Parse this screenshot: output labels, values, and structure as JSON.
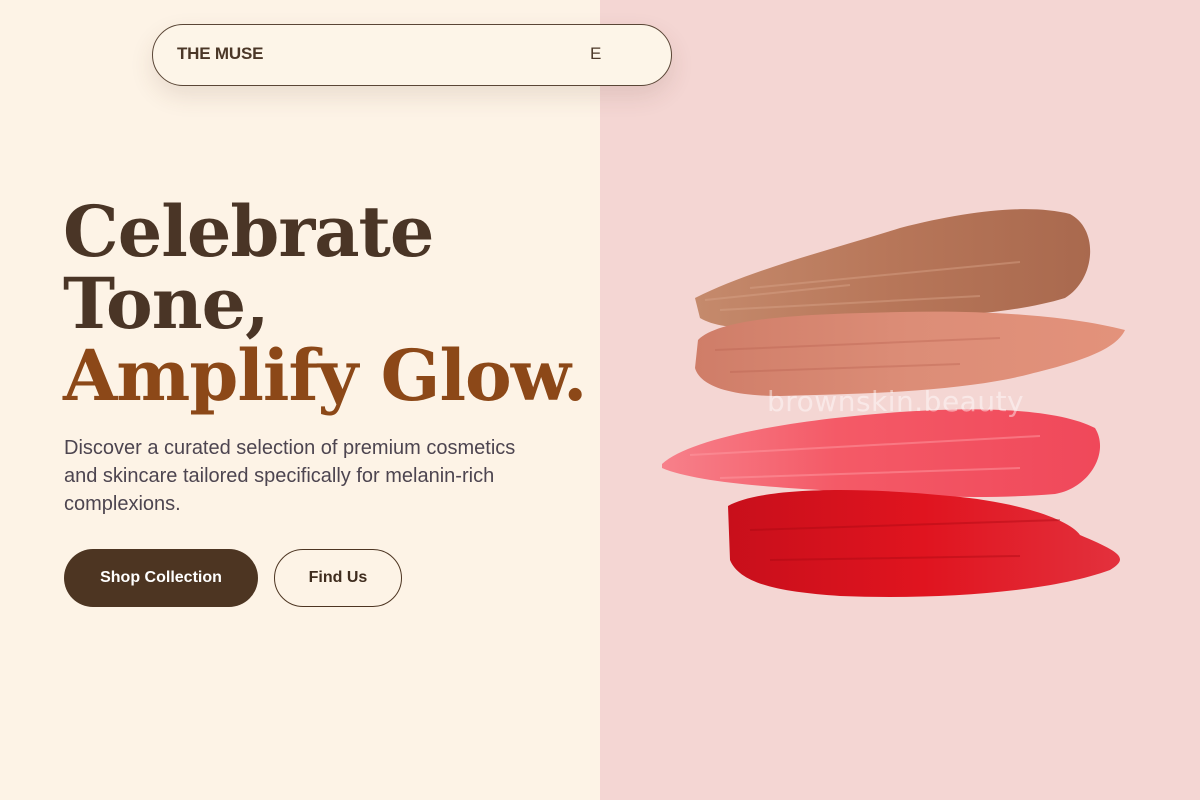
{
  "nav": {
    "brand": "THE MUSE",
    "partial_item": "E"
  },
  "hero": {
    "headline_line1": "Celebrate",
    "headline_line2": "Tone,",
    "headline_accent": "Amplify Glow.",
    "description": "Discover a curated selection of premium cosmetics and skincare tailored specifically for melanin-rich complexions.",
    "primary_button": "Shop Collection",
    "secondary_button": "Find Us"
  },
  "image": {
    "watermark": "brownskin.beauty",
    "swatches": [
      "nude-brown",
      "peach-coral",
      "pink-red",
      "crimson-red"
    ]
  },
  "colors": {
    "background": "#fdf3e6",
    "panel": "#f4d6d3",
    "brand_dark": "#4b3727",
    "accent": "#8c4818",
    "swatch_1": "#b67659",
    "swatch_2": "#d98772",
    "swatch_3": "#f2535f",
    "swatch_4": "#d91421"
  }
}
